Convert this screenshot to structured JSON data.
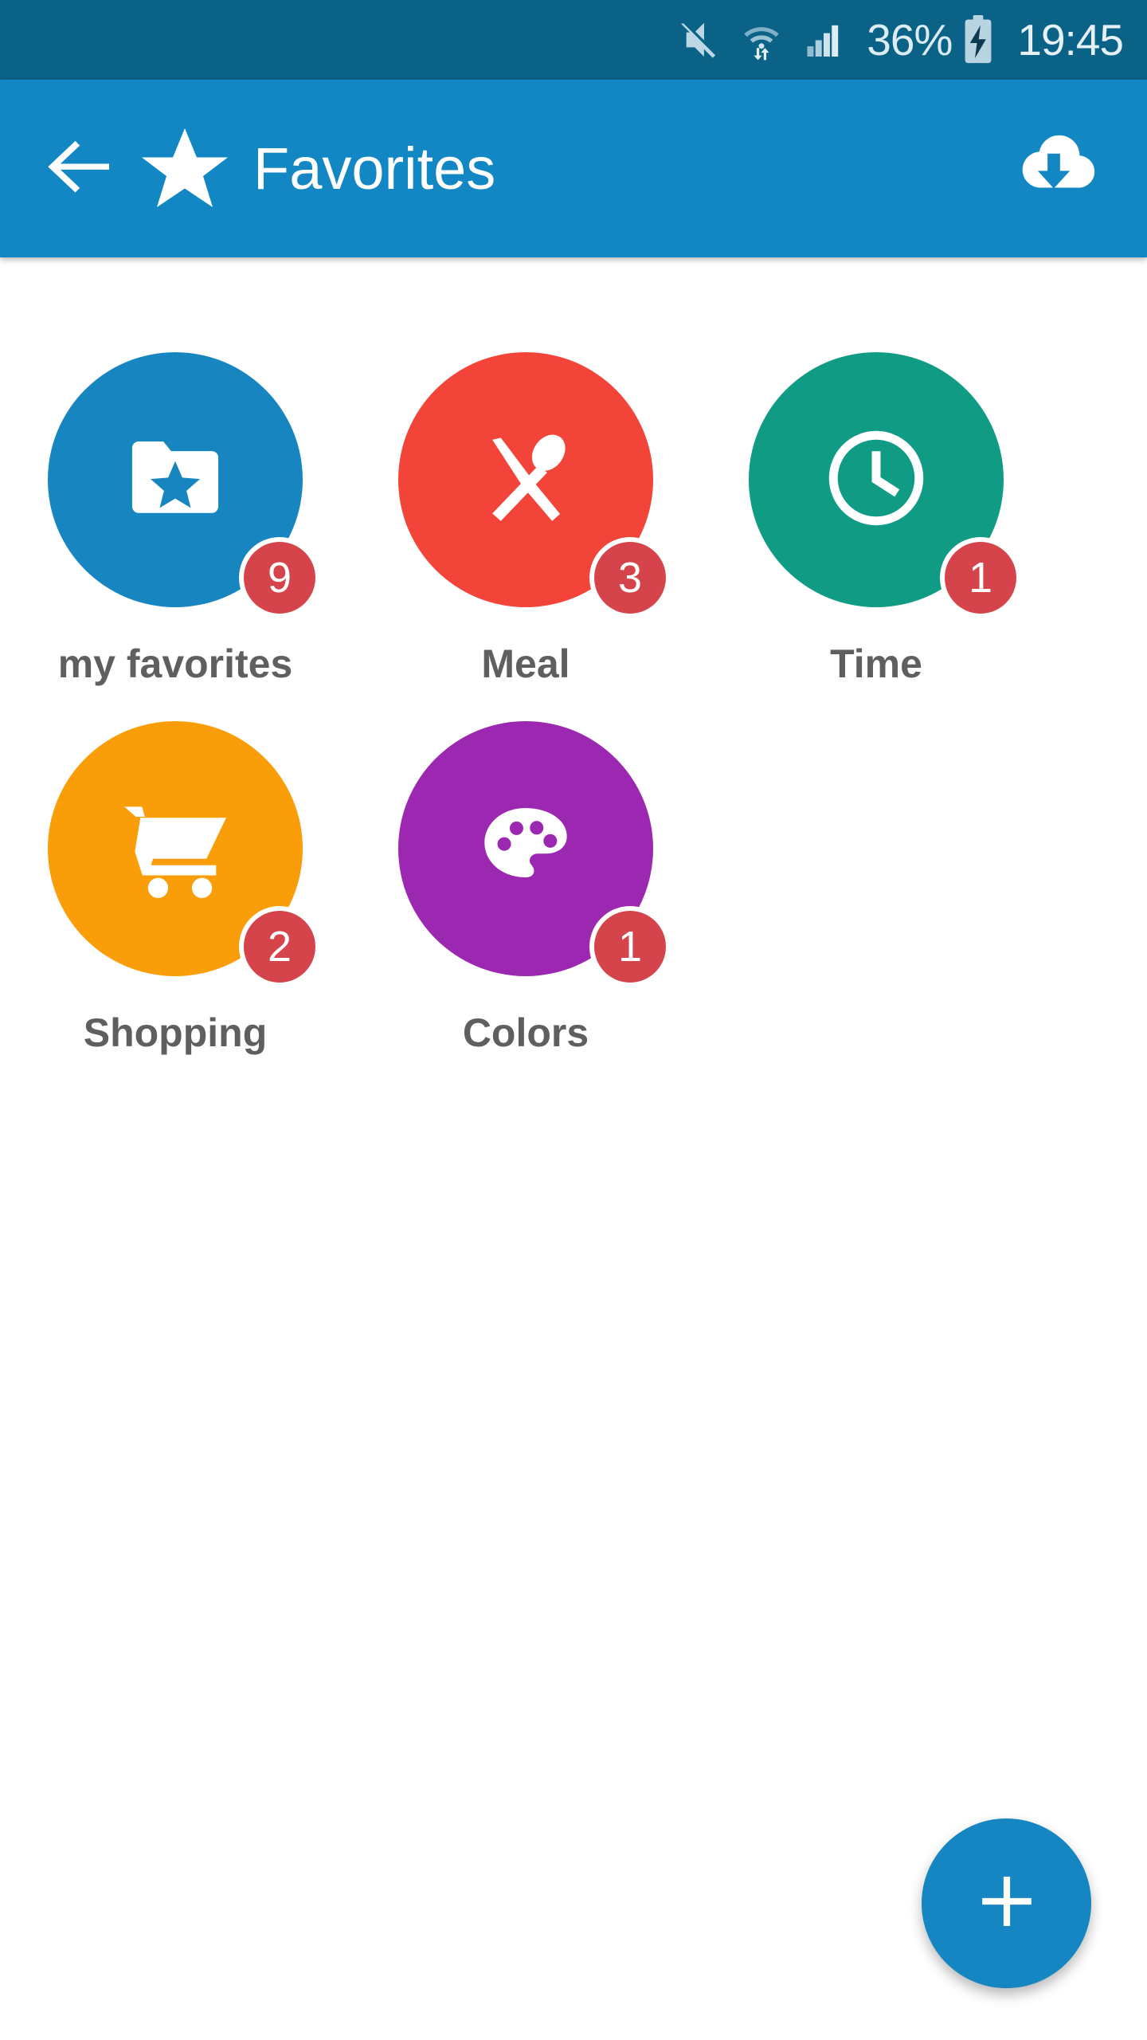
{
  "status_bar": {
    "background": "#0b6287",
    "icons": [
      "mute-icon",
      "wifi-transfer-icon",
      "cellular-signal-icon"
    ],
    "battery_percent": "36%",
    "battery_icon": "battery-charging-icon",
    "clock": "19:45"
  },
  "app_bar": {
    "background": "#1287c4",
    "back_icon": "arrow-back-icon",
    "leading_icon": "star-icon",
    "title": "Favorites",
    "action_icon": "cloud-download-icon"
  },
  "tiles": [
    {
      "label": "my favorites",
      "badge": "9",
      "color": "#1786c0",
      "icon": "folder-star-icon"
    },
    {
      "label": "Meal",
      "badge": "3",
      "color": "#f3443a",
      "icon": "cutlery-icon"
    },
    {
      "label": "Time",
      "badge": "1",
      "color": "#109b85",
      "icon": "clock-icon"
    },
    {
      "label": "Shopping",
      "badge": "2",
      "color": "#f99d08",
      "icon": "shopping-cart-icon"
    },
    {
      "label": "Colors",
      "badge": "1",
      "color": "#9c27b0",
      "icon": "palette-icon"
    }
  ],
  "badge_color": "#d5444a",
  "label_color": "#5f5f5f",
  "fab": {
    "icon": "plus-icon",
    "label": "+",
    "color": "#1686c2"
  }
}
